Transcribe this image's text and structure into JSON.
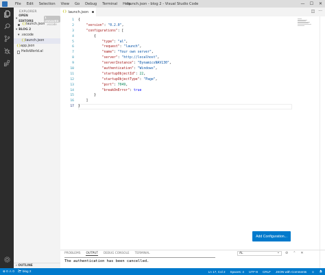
{
  "window": {
    "title": "launch.json - blog 2 - Visual Studio Code",
    "menu": [
      "File",
      "Edit",
      "Selection",
      "View",
      "Go",
      "Debug",
      "Terminal",
      "Help"
    ],
    "controls": {
      "minimize": "—",
      "maximize": "☐",
      "close": "✕"
    }
  },
  "activity_bar": {
    "items": [
      "explorer-icon",
      "search-icon",
      "source-control-icon",
      "debug-icon",
      "extensions-icon"
    ],
    "settings_icon": "gear-icon"
  },
  "sidebar": {
    "title": "EXPLORER",
    "open_editors": {
      "header": "OPEN EDITORS",
      "badge": "1 UNSAVED",
      "items": [
        {
          "name": "launch.json",
          "path": ".vscode",
          "modified": true
        }
      ]
    },
    "workspace": {
      "header": "BLOG 2",
      "folder": ".vscode",
      "files": [
        {
          "name": "launch.json",
          "selected": true
        },
        {
          "name": "app.json",
          "selected": false
        },
        {
          "name": "HelloWorld.al",
          "selected": false
        }
      ]
    },
    "outline_header": "OUTLINE"
  },
  "tab": {
    "label": "launch.json",
    "modified": true
  },
  "editor": {
    "line_numbers": [
      "1",
      "2",
      "3",
      "4",
      "5",
      "6",
      "7",
      "8",
      "9",
      "10",
      "11",
      "12",
      "13",
      "14",
      "15",
      "16",
      "17"
    ],
    "active_line": 17
  },
  "launch_config": {
    "version": "0.2.0",
    "configurations": [
      {
        "type": "al",
        "request": "launch",
        "name": "Your own server",
        "server": "http://localhost",
        "serverInstance": "DynamicsNAV130",
        "authentication": "Windows",
        "startupObjectId": 22,
        "startupObjectType": "Page",
        "port": 7049,
        "breakOnError": true
      }
    ]
  },
  "add_configuration_button": "Add Configuration...",
  "panel": {
    "tabs": [
      "PROBLEMS",
      "OUTPUT",
      "DEBUG CONSOLE",
      "TERMINAL"
    ],
    "active_tab": "OUTPUT",
    "channel": "AL",
    "message": "The authentication has been cancelled."
  },
  "status_bar": {
    "errors": "0",
    "warnings": "0",
    "folder": "blog 2",
    "position": "Ln 17, Col 2",
    "indent": "Spaces: 4",
    "encoding": "UTF-8",
    "eol": "CRLF",
    "language": "JSON with Comments"
  },
  "colors": {
    "accent": "#007acc",
    "activity_bar": "#2c2c2c",
    "sidebar": "#f3f3f3",
    "json_key": "#a31515",
    "json_string": "#0451a5",
    "json_number": "#098658",
    "json_boolean": "#0000ff"
  }
}
